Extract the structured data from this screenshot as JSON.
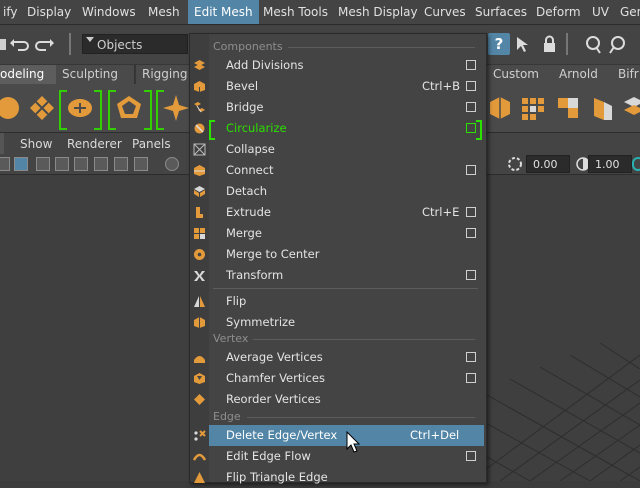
{
  "menubar": [
    "ify",
    "Display",
    "Windows",
    "Mesh",
    "Edit Mesh",
    "Mesh Tools",
    "Mesh Display",
    "Curves",
    "Surfaces",
    "Deform",
    "UV",
    "Gen"
  ],
  "statusline": {
    "objects_label": "Objects"
  },
  "shelf_tabs": [
    "odeling",
    "Sculpting",
    "Rigging",
    "Custom",
    "Arnold",
    "Bifr"
  ],
  "panel_menu": [
    "Show",
    "Renderer",
    "Panels"
  ],
  "panel_tools": {
    "value1": "0.00",
    "value2": "1.00"
  },
  "dropdown": {
    "headers": {
      "components": "Components",
      "vertex": "Vertex",
      "edge": "Edge"
    },
    "items": [
      {
        "label": "Add Divisions",
        "shortcut": "",
        "box": true
      },
      {
        "label": "Bevel",
        "shortcut": "Ctrl+B",
        "box": true
      },
      {
        "label": "Bridge",
        "shortcut": "",
        "box": true
      },
      {
        "label": "Circularize",
        "shortcut": "",
        "box": true
      },
      {
        "label": "Collapse",
        "shortcut": "",
        "box": false
      },
      {
        "label": "Connect",
        "shortcut": "",
        "box": true
      },
      {
        "label": "Detach",
        "shortcut": "",
        "box": false
      },
      {
        "label": "Extrude",
        "shortcut": "Ctrl+E",
        "box": true
      },
      {
        "label": "Merge",
        "shortcut": "",
        "box": true
      },
      {
        "label": "Merge to Center",
        "shortcut": "",
        "box": false
      },
      {
        "label": "Transform",
        "shortcut": "",
        "box": true
      },
      {
        "label": "Flip",
        "shortcut": "",
        "box": false
      },
      {
        "label": "Symmetrize",
        "shortcut": "",
        "box": false
      },
      {
        "label": "Average Vertices",
        "shortcut": "",
        "box": true
      },
      {
        "label": "Chamfer Vertices",
        "shortcut": "",
        "box": true
      },
      {
        "label": "Reorder Vertices",
        "shortcut": "",
        "box": false
      },
      {
        "label": "Delete Edge/Vertex",
        "shortcut": "Ctrl+Del",
        "box": false
      },
      {
        "label": "Edit Edge Flow",
        "shortcut": "",
        "box": true
      },
      {
        "label": "Flip Triangle Edge",
        "shortcut": "",
        "box": false
      }
    ]
  },
  "colors": {
    "highlight": "#5285a6",
    "accent_green": "#2ce000",
    "icon_orange": "#e39a3b"
  }
}
